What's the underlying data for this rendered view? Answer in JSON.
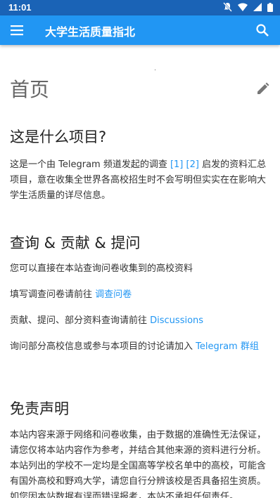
{
  "status": {
    "time": "11:01"
  },
  "appbar": {
    "title": "大学生活质量指北"
  },
  "page": {
    "title": "首页"
  },
  "sections": {
    "what": {
      "heading": "这是什么项目?",
      "text_before": "这是一个由 Telegram 频道发起的调查 ",
      "ref1": "[1]",
      "ref2": "[2]",
      "text_after": " 启发的资料汇总项目，意在收集全世界各高校招生时不会写明但实实在在影响大学生活质量的详尽信息。"
    },
    "query": {
      "heading": "查询 & 贡献 & 提问",
      "line1": "您可以直接在本站查询问卷收集到的高校资料",
      "line2_text": "填写调查问卷请前往 ",
      "line2_link": "调查问卷",
      "line3_text": "贡献、提问、部分资料查询请前往 ",
      "line3_link": "Discussions",
      "line4_text": "询问部分高校信息或参与本项目的讨论请加入 ",
      "line4_link": "Telegram 群组"
    },
    "disclaimer": {
      "heading": "免责声明",
      "text": "本站内容来源于网络和问卷收集，由于数据的准确性无法保证，请您仅将本站内容作为参考，并结合其他来源的资料进行分析。本站列出的学校不一定均是全国高等学校名单中的高校，可能含有国外高校和野鸡大学，请您自行分辨该校是否具备招生资质。如您因本站数据有误而错误报考，本站不承担任何责任。"
    }
  }
}
